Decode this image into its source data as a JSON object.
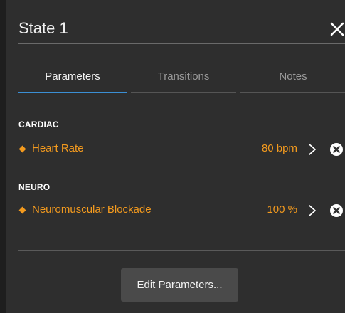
{
  "panel": {
    "title": "State 1"
  },
  "tabs": [
    {
      "label": "Parameters",
      "active": true
    },
    {
      "label": "Transitions",
      "active": false
    },
    {
      "label": "Notes",
      "active": false
    }
  ],
  "sections": [
    {
      "title": "CARDIAC",
      "params": [
        {
          "label": "Heart Rate",
          "value": "80 bpm"
        }
      ]
    },
    {
      "title": "NEURO",
      "params": [
        {
          "label": "Neuromuscular Blockade",
          "value": "100 %"
        }
      ]
    }
  ],
  "footer": {
    "edit_button_label": "Edit Parameters..."
  },
  "colors": {
    "background": "#2e2e2e",
    "accent_orange": "#f39a1e",
    "active_tab_underline": "#3b8fd4",
    "button_bg": "#4a4a4a"
  },
  "icons": {
    "close": "close-icon",
    "chevron": "chevron-right-icon",
    "remove": "remove-circle-icon",
    "bullet": "diamond-icon"
  }
}
